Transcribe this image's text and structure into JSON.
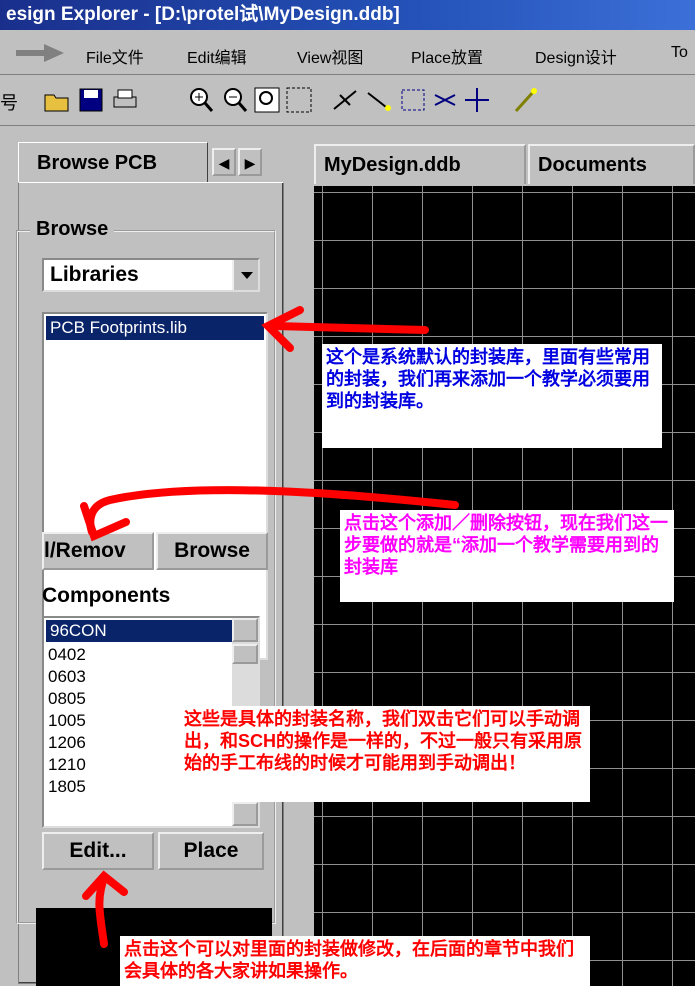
{
  "title": "esign Explorer - [D:\\protel试\\MyDesign.ddb]",
  "menu": [
    "File文件",
    "Edit编辑",
    "View视图",
    "Place放置",
    "Design设计",
    "To"
  ],
  "side_fragment": "号",
  "panel": {
    "tab_label": "Browse PCB",
    "group_label": "Browse",
    "browse_type": "Libraries",
    "libraries": [
      "PCB Footprints.lib"
    ],
    "add_remove_button": "l/Remov",
    "browse_button": "Browse",
    "components_label": "Components",
    "components": [
      "96CON",
      "0402",
      "0603",
      "0805",
      "1005",
      "1206",
      "1210",
      "1805"
    ],
    "edit_button": "Edit...",
    "place_button": "Place"
  },
  "doc_tabs": [
    "MyDesign.ddb",
    "Documents"
  ],
  "notes": {
    "library_note": "这个是系统默认的封装库，里面有些常用的封装，我们再来添加一个教学必须要用到的封装库。",
    "button_note": "点击这个添加／删除按钮，现在我们这一步要做的就是“添加一个教学需要用到的封装库",
    "components_note": "这些是具体的封装名称，我们双击它们可以手动调出，和SCH的操作是一样的，不过一般只有采用原始的手工布线的时候才可能用到手动调出！",
    "edit_note": "点击这个可以对里面的封装做修改，在后面的章节中我们会具体的各大家讲如果操作。"
  },
  "colors": {
    "note_blue": "#0000e0",
    "note_magenta": "#ff00ff",
    "note_red": "#ff0000",
    "arrow_red": "#ff0000"
  }
}
